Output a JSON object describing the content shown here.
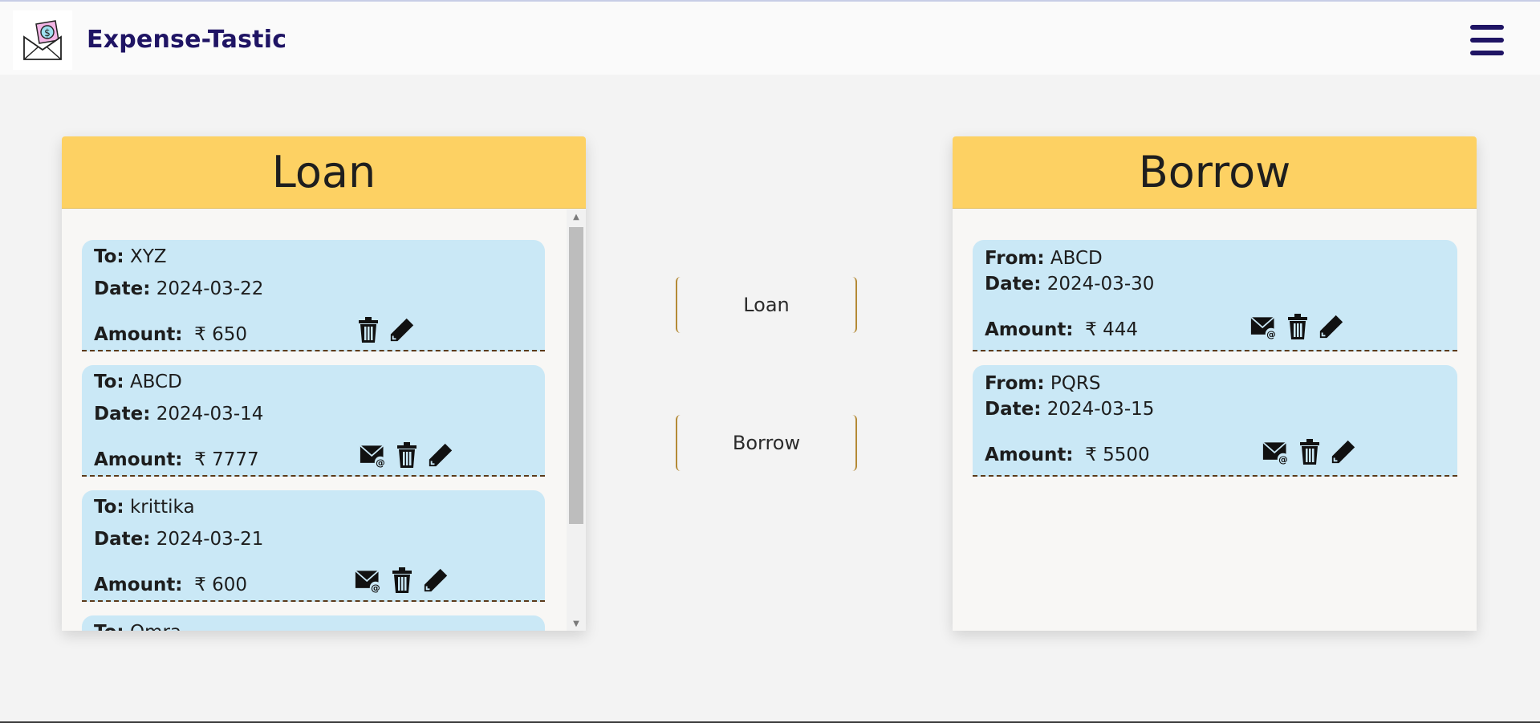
{
  "header": {
    "app_title": "Expense-Tastic",
    "logo_icon": "money-envelope-icon",
    "menu_icon": "hamburger-menu-icon"
  },
  "colors": {
    "header_bg": "#fafafa",
    "brand_text": "#1f1464",
    "panel_header": "#fdd163",
    "card_bg": "#cae8f6",
    "button_border": "#b48a36"
  },
  "loan_panel": {
    "title": "Loan",
    "entries": [
      {
        "to_label": "To:",
        "to_value": "XYZ",
        "date_label": "Date:",
        "date_value": "2024-03-22",
        "amount_label": "Amount:",
        "amount_value": "₹ 650",
        "icons": [
          "delete-icon",
          "edit-icon"
        ]
      },
      {
        "to_label": "To:",
        "to_value": "ABCD",
        "date_label": "Date:",
        "date_value": "2024-03-14",
        "amount_label": "Amount:",
        "amount_value": "₹ 7777",
        "icons": [
          "email-icon",
          "delete-icon",
          "edit-icon"
        ]
      },
      {
        "to_label": "To:",
        "to_value": "krittika",
        "date_label": "Date:",
        "date_value": "2024-03-21",
        "amount_label": "Amount:",
        "amount_value": "₹ 600",
        "icons": [
          "email-icon",
          "delete-icon",
          "edit-icon"
        ]
      },
      {
        "to_label": "To:",
        "to_value": "Omra"
      }
    ]
  },
  "borrow_panel": {
    "title": "Borrow",
    "entries": [
      {
        "from_label": "From:",
        "from_value": "ABCD",
        "date_label": "Date:",
        "date_value": "2024-03-30",
        "amount_label": "Amount:",
        "amount_value": "₹ 444",
        "icons": [
          "email-icon",
          "delete-icon",
          "edit-icon"
        ]
      },
      {
        "from_label": "From:",
        "from_value": "PQRS",
        "date_label": "Date:",
        "date_value": "2024-03-15",
        "amount_label": "Amount:",
        "amount_value": "₹ 5500",
        "icons": [
          "email-icon",
          "delete-icon",
          "edit-icon"
        ]
      }
    ]
  },
  "actions": {
    "loan_button": "Loan",
    "borrow_button": "Borrow"
  }
}
